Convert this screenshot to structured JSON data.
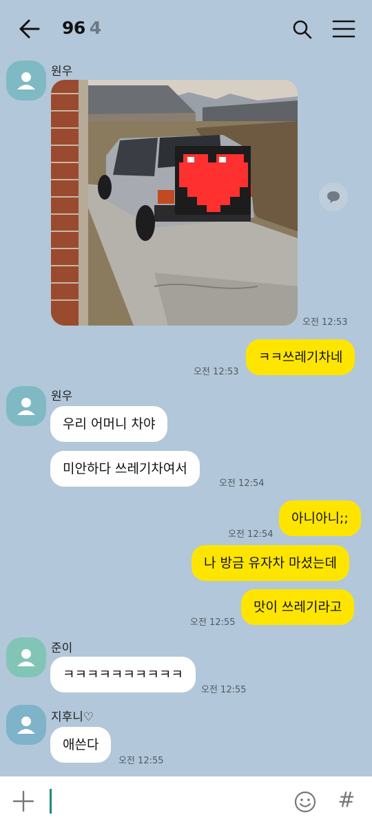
{
  "header": {
    "title": "96",
    "member_count": "4"
  },
  "composer": {
    "placeholder": ""
  },
  "messages": [
    {
      "sender": "원우",
      "type": "photo",
      "time": "오전 12:53"
    },
    {
      "from": "me",
      "text": "ㅋㅋ쓰레기차네",
      "time": "오전 12:53"
    },
    {
      "sender": "원우",
      "text": "우리 어머니 차야"
    },
    {
      "text": "미안하다 쓰레기차여서",
      "time": "오전 12:54"
    },
    {
      "from": "me",
      "text": "아니아니;;",
      "time": "오전 12:54"
    },
    {
      "from": "me",
      "text": "나 방금 유자차 마셨는데"
    },
    {
      "from": "me",
      "text": "맛이 쓰레기라고",
      "time": "오전 12:55"
    },
    {
      "sender": "준이",
      "text": "ㅋㅋㅋㅋㅋㅋㅋㅋㅋㅋ",
      "time": "오전 12:55"
    },
    {
      "sender": "지후니♡",
      "text": "애쓴다",
      "time": "오전 12:55"
    }
  ],
  "colors": {
    "background": "#b2c7d9",
    "my_bubble": "#fee500",
    "their_bubble": "#ffffff",
    "composer_cursor": "#1b8a78"
  }
}
